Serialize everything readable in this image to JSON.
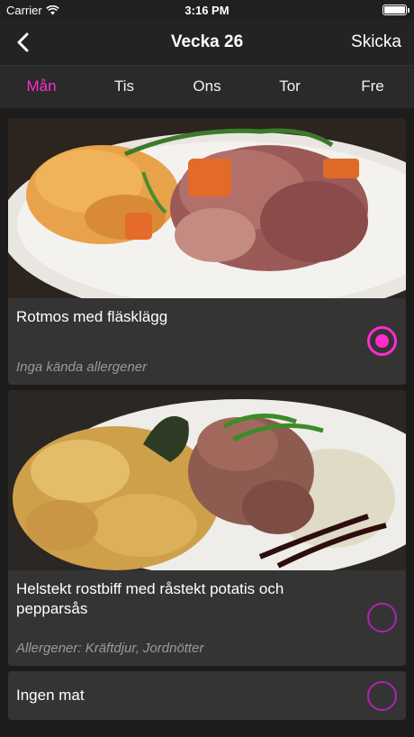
{
  "status_bar": {
    "carrier": "Carrier",
    "time": "3:16 PM"
  },
  "nav": {
    "title": "Vecka 26",
    "send_label": "Skicka"
  },
  "tabs": [
    {
      "label": "Mån",
      "active": true
    },
    {
      "label": "Tis",
      "active": false
    },
    {
      "label": "Ons",
      "active": false
    },
    {
      "label": "Tor",
      "active": false
    },
    {
      "label": "Fre",
      "active": false
    }
  ],
  "meals": [
    {
      "title": "Rotmos med fläsklägg",
      "allergens": "Inga kända allergener",
      "selected": true
    },
    {
      "title": "Helstekt rostbiff med råstekt potatis och pepparsås",
      "allergens": "Allergener: Kräftdjur, Jordnötter",
      "selected": false
    },
    {
      "title": "Ingen mat",
      "allergens": "",
      "selected": false
    }
  ],
  "colors": {
    "accent": "#ff2bd0",
    "radio_unselected": "#b023b0",
    "background": "#1c1c1c",
    "card": "#343434"
  }
}
